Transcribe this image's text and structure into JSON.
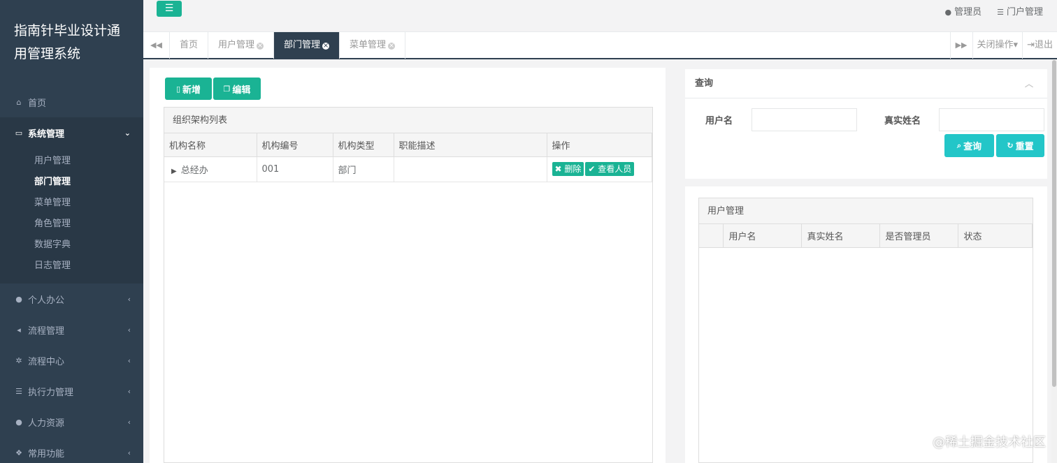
{
  "sidebar": {
    "brand": "指南针毕业设计通用管理系统",
    "items": [
      {
        "label": "首页",
        "icon": "home-icon"
      },
      {
        "label": "系统管理",
        "icon": "monitor-icon"
      },
      {
        "label": "个人办公",
        "icon": "user-icon"
      },
      {
        "label": "流程管理",
        "icon": "share-icon"
      },
      {
        "label": "流程中心",
        "icon": "gear-icon"
      },
      {
        "label": "执行力管理",
        "icon": "list-icon"
      },
      {
        "label": "人力资源",
        "icon": "user-plus-icon"
      },
      {
        "label": "常用功能",
        "icon": "cubes-icon"
      }
    ],
    "sub_items": [
      "用户管理",
      "部门管理",
      "菜单管理",
      "角色管理",
      "数据字典",
      "日志管理"
    ]
  },
  "topbar": {
    "admin": "管理员",
    "portal": "门户管理"
  },
  "tabs": {
    "items": [
      "首页",
      "用户管理",
      "部门管理",
      "菜单管理"
    ],
    "active": "部门管理",
    "close_ops": "关闭操作",
    "logout": "退出"
  },
  "org": {
    "add_label": "新增",
    "edit_label": "编辑",
    "title": "组织架构列表",
    "columns": [
      "机构名称",
      "机构编号",
      "机构类型",
      "职能描述",
      "操作"
    ],
    "rows": [
      {
        "name": "总经办",
        "code": "001",
        "type": "部门",
        "desc": "",
        "delete": "删除",
        "view": "查看人员"
      }
    ]
  },
  "query": {
    "title": "查询",
    "username_label": "用户名",
    "realname_label": "真实姓名",
    "username_value": "",
    "realname_value": "",
    "search_label": "查询",
    "reset_label": "重置"
  },
  "users": {
    "title": "用户管理",
    "columns": [
      "",
      "用户名",
      "真实姓名",
      "是否管理员",
      "状态"
    ]
  },
  "watermark": "@稀土掘金技术社区",
  "colors": {
    "sidebar": "#2f4050",
    "accent": "#1ab394",
    "query_button": "#23c6c8"
  }
}
